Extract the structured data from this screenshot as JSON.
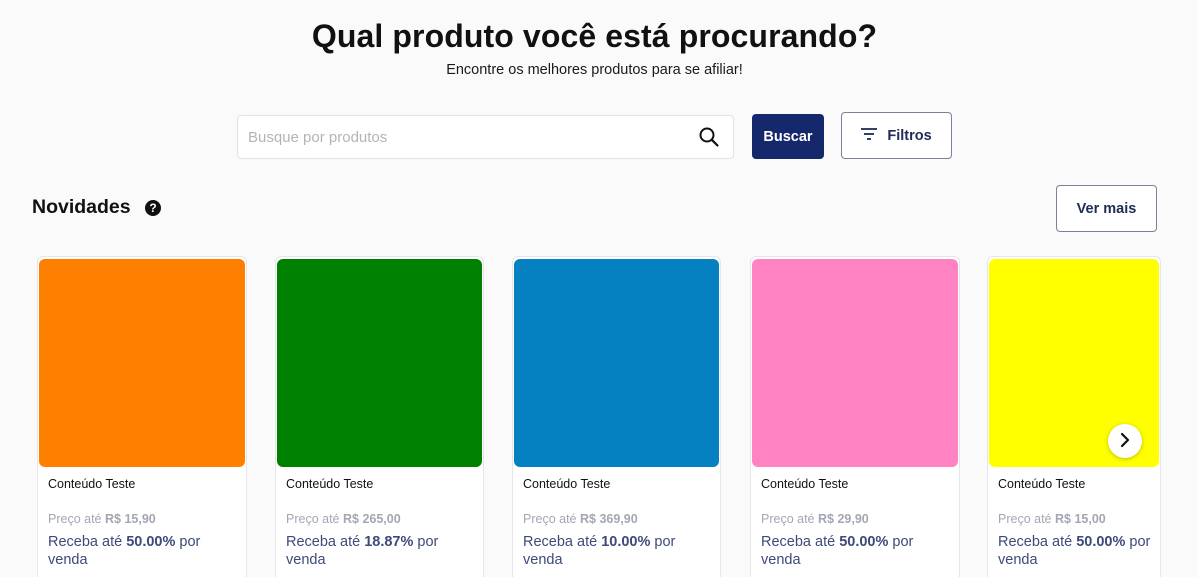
{
  "header": {
    "title": "Qual produto você está procurando?",
    "subtitle": "Encontre os melhores produtos para se afiliar!"
  },
  "search": {
    "placeholder": "Busque por produtos",
    "value": "",
    "icon": "search-icon",
    "button_label": "Buscar",
    "filters_label": "Filtros",
    "filters_icon": "filter-lines-icon"
  },
  "section": {
    "title": "Novidades",
    "help_icon": "question-circle-icon",
    "help_glyph": "?",
    "see_more_label": "Ver mais"
  },
  "products": [
    {
      "name": "Conteúdo Teste",
      "price_prefix": "Preço até",
      "price": "R$ 15,90",
      "earn_prefix": "Receba até",
      "commission": "50.00%",
      "earn_suffix": "por venda",
      "color": "#ff7f00"
    },
    {
      "name": "Conteúdo Teste",
      "price_prefix": "Preço até",
      "price": "R$ 265,00",
      "earn_prefix": "Receba até",
      "commission": "18.87%",
      "earn_suffix": "por venda",
      "color": "#008000"
    },
    {
      "name": "Conteúdo Teste",
      "price_prefix": "Preço até",
      "price": "R$ 369,90",
      "earn_prefix": "Receba até",
      "commission": "10.00%",
      "earn_suffix": "por venda",
      "color": "#0580c1"
    },
    {
      "name": "Conteúdo Teste",
      "price_prefix": "Preço até",
      "price": "R$ 29,90",
      "earn_prefix": "Receba até",
      "commission": "50.00%",
      "earn_suffix": "por venda",
      "color": "#ff82c2"
    },
    {
      "name": "Conteúdo Teste",
      "price_prefix": "Preço até",
      "price": "R$ 15,00",
      "earn_prefix": "Receba até",
      "commission": "50.00%",
      "earn_suffix": "por venda",
      "color": "#ffff00"
    }
  ],
  "carousel": {
    "next_icon": "chevron-right-icon"
  },
  "colors": {
    "primary": "#14286b",
    "text": "#111111",
    "muted": "#a3a6b3",
    "accent_text": "#3d4a7a"
  }
}
